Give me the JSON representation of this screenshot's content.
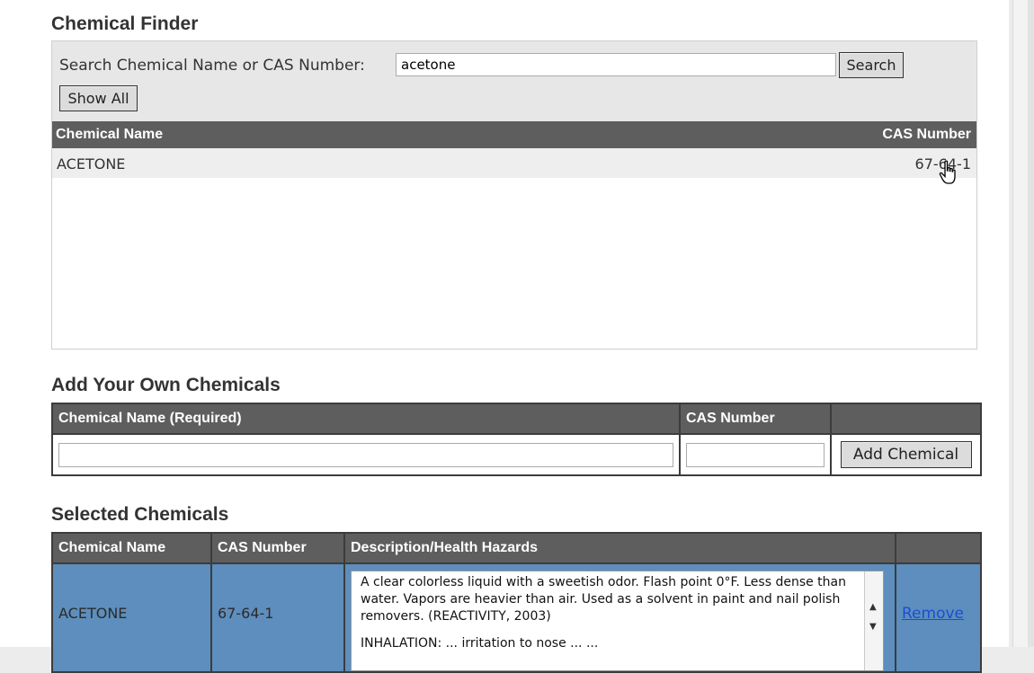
{
  "finder": {
    "title": "Chemical Finder",
    "search_label": "Search Chemical Name or CAS Number:",
    "search_value": "acetone",
    "search_button": "Search",
    "show_all_button": "Show All",
    "columns": [
      "Chemical Name",
      "CAS Number"
    ],
    "results": [
      {
        "name": "ACETONE",
        "cas": "67-64-1"
      }
    ]
  },
  "add_own": {
    "title": "Add Your Own Chemicals",
    "columns": [
      "Chemical Name (Required)",
      "CAS Number",
      ""
    ],
    "name_value": "",
    "cas_value": "",
    "add_button": "Add Chemical"
  },
  "selected": {
    "title": "Selected Chemicals",
    "columns": [
      "Chemical Name",
      "CAS Number",
      "Description/Health Hazards",
      ""
    ],
    "rows": [
      {
        "name": "ACETONE",
        "cas": "67-64-1",
        "description": "A clear colorless liquid with a sweetish odor. Flash point 0°F. Less dense than water. Vapors are heavier than air. Used as a solvent in paint and nail polish removers. (REACTIVITY, 2003)",
        "description_more": "INHALATION: ... irritation to nose ... ...",
        "remove_label": "Remove"
      }
    ]
  },
  "icons": {
    "scroll_up": "triangle-up-icon",
    "scroll_down": "triangle-down-icon",
    "cursor": "hand-pointer-icon"
  },
  "colors": {
    "header_bg": "#5e5e5e",
    "selected_row_bg": "#5d8ebd",
    "link": "#1a4fd0"
  }
}
